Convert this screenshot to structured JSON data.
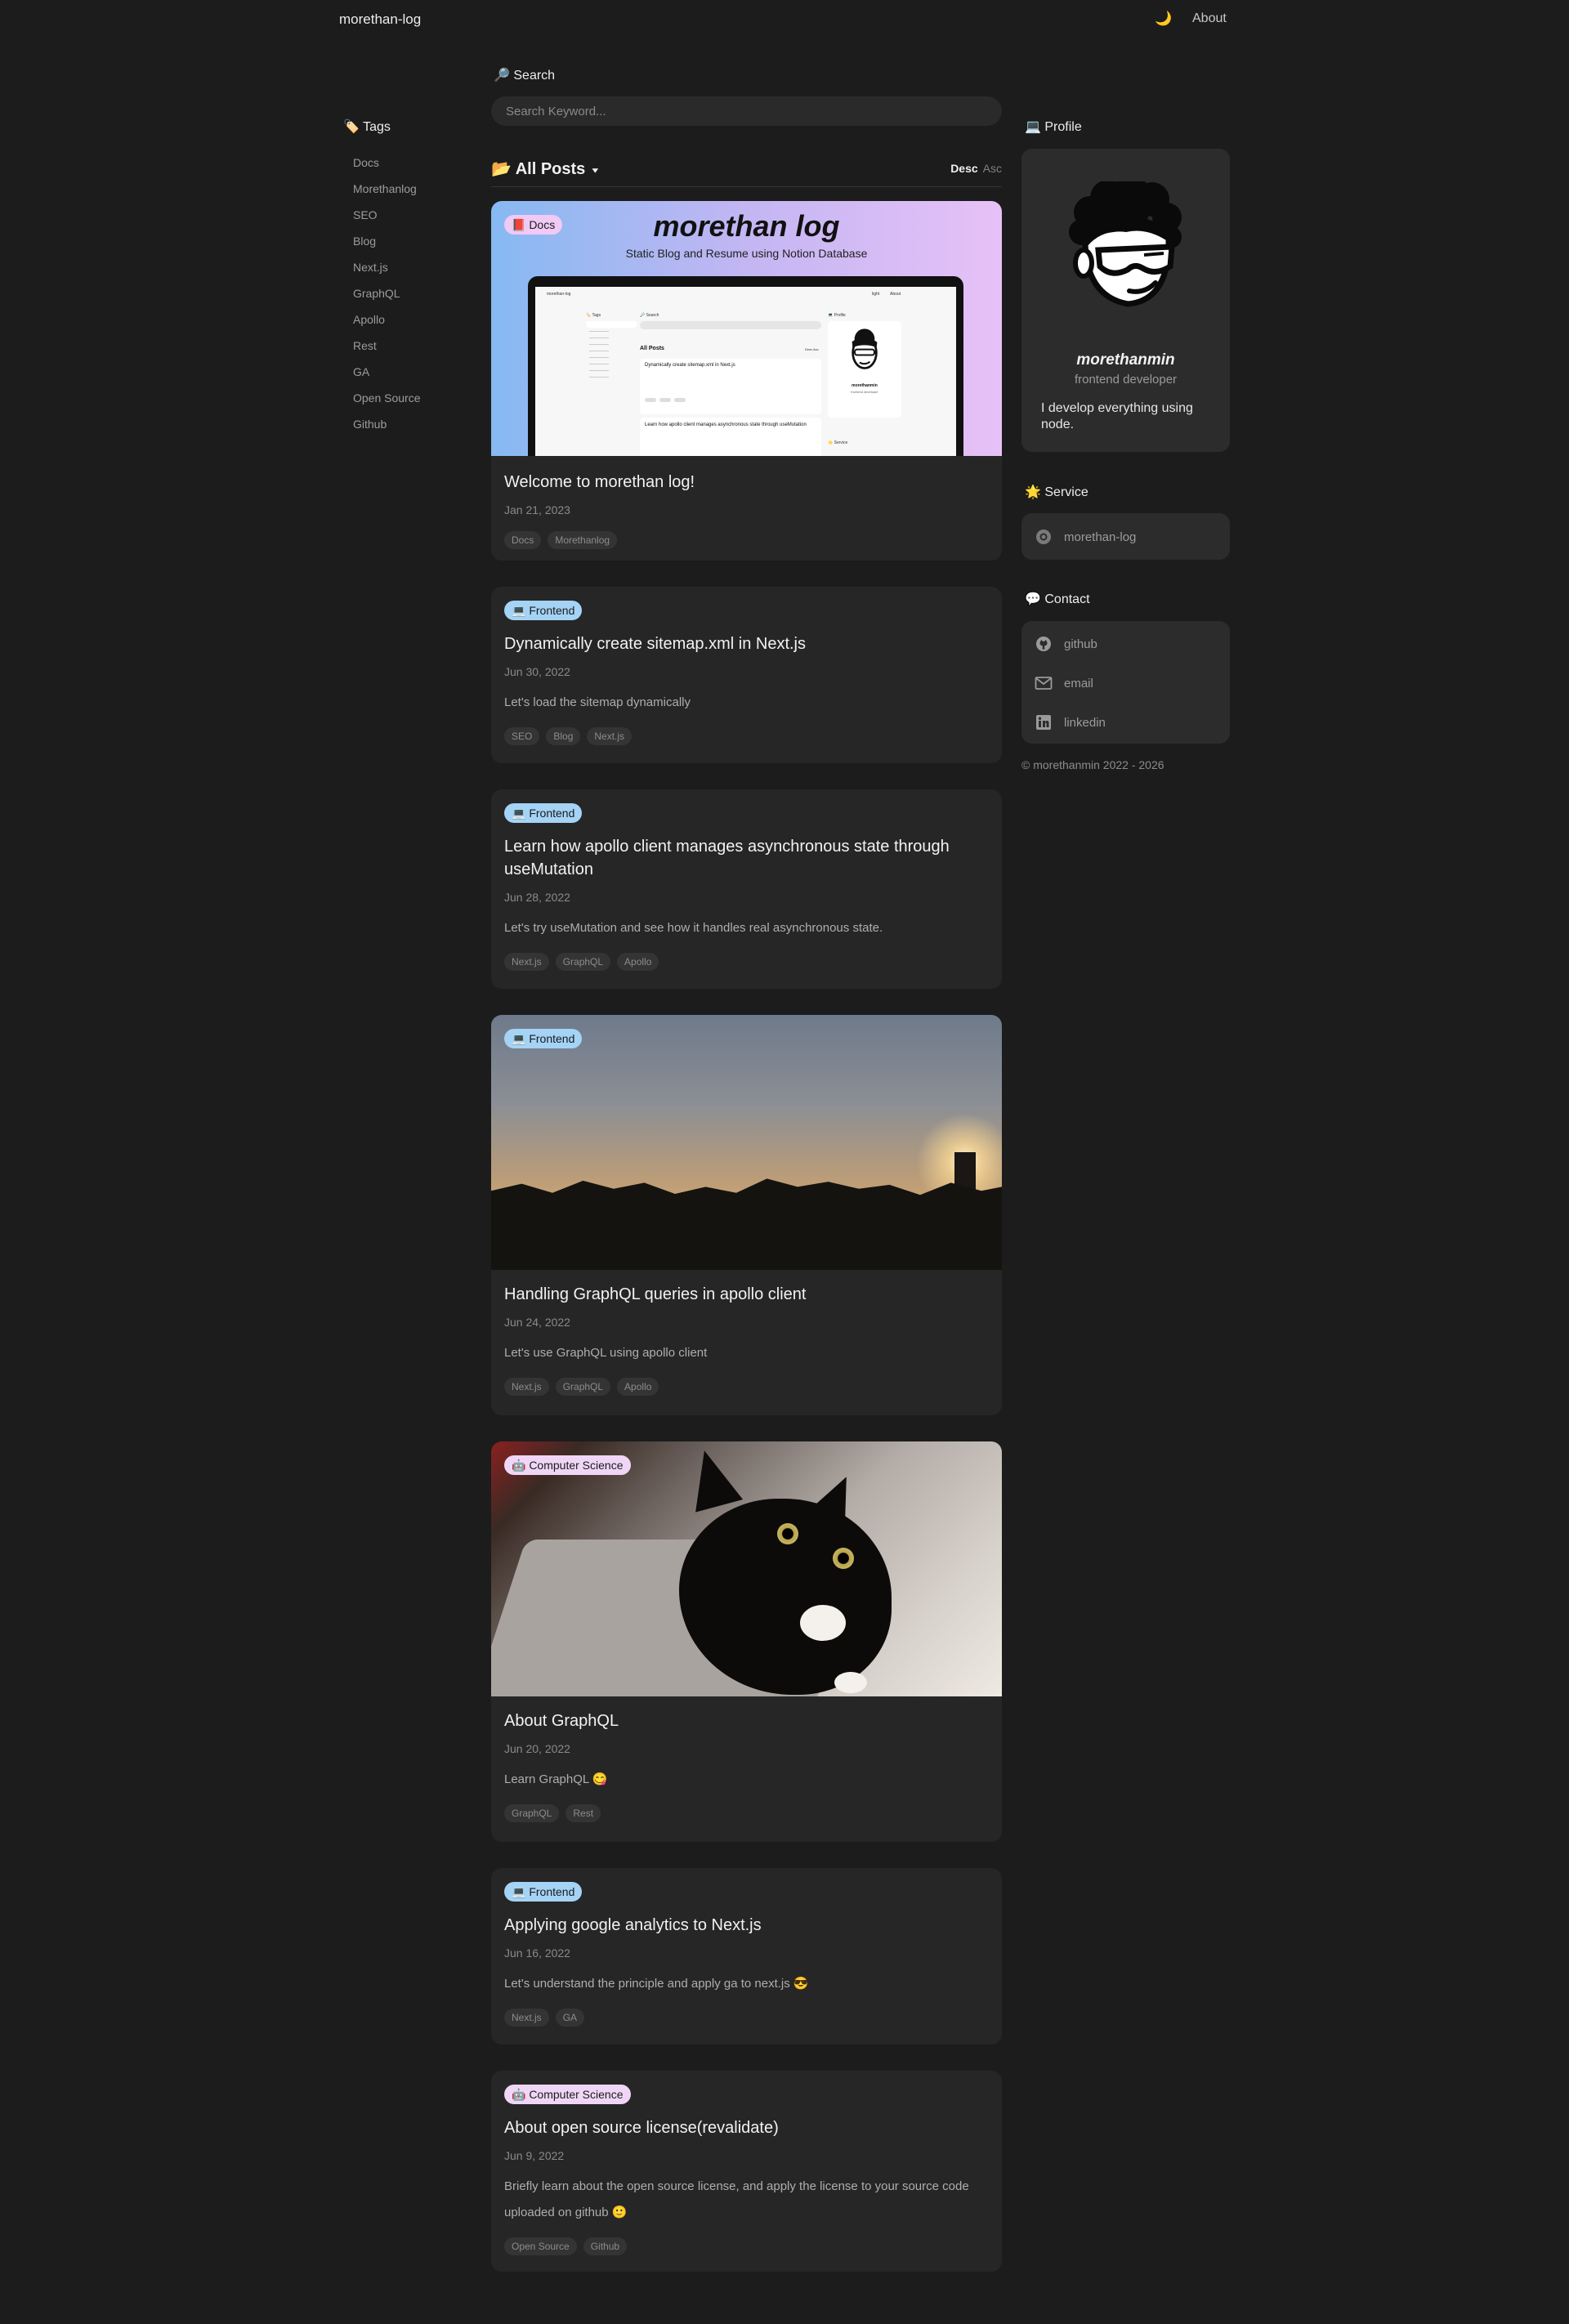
{
  "header": {
    "brand": "morethan-log",
    "theme_icon": "moon-icon",
    "about": "About"
  },
  "search": {
    "heading": "🔎 Search",
    "placeholder": "Search Keyword..."
  },
  "tags": {
    "heading": "🏷️ Tags",
    "items": [
      "Docs",
      "Morethanlog",
      "SEO",
      "Blog",
      "Next.js",
      "GraphQL",
      "Apollo",
      "Rest",
      "GA",
      "Open Source",
      "Github"
    ]
  },
  "feed": {
    "title": "📂 All Posts",
    "sort_desc": "Desc",
    "sort_asc": "Asc"
  },
  "posts": [
    {
      "category": "📕 Docs",
      "title": "Welcome to morethan log!",
      "date": "Jan 21, 2023",
      "summary": "",
      "tags": [
        "Docs",
        "Morethanlog"
      ],
      "thumb": {
        "heading": "morethan log",
        "subheading": "Static Blog and Resume using Notion Database",
        "mini_brand": "morethan-log",
        "mini_light": "light",
        "mini_about": "About",
        "mini_search": "🔎 Search",
        "mini_tags": "🏷️ Tags",
        "mini_feed": "All Posts",
        "mini_sort": "Desc Asc",
        "mini_profile": "💻 Profile",
        "mini_post1": "Dynamically create sitemap.xml in Next.js",
        "mini_post2": "Learn how apollo client manages asynchronous state through useMutation",
        "mini_name": "morethanmin",
        "mini_role": "frontend developer",
        "mini_service": "🌟 Service"
      }
    },
    {
      "category": "💻 Frontend",
      "title": "Dynamically create sitemap.xml in Next.js",
      "date": "Jun 30, 2022",
      "summary": "Let's load the sitemap dynamically",
      "tags": [
        "SEO",
        "Blog",
        "Next.js"
      ]
    },
    {
      "category": "💻 Frontend",
      "title": "Learn how apollo client manages asynchronous state through useMutation",
      "date": "Jun 28, 2022",
      "summary": "Let's try useMutation and see how it handles real asynchronous state.",
      "tags": [
        "Next.js",
        "GraphQL",
        "Apollo"
      ]
    },
    {
      "category": "💻 Frontend",
      "title": "Handling GraphQL queries in apollo client",
      "date": "Jun 24, 2022",
      "summary": "Let's use GraphQL using apollo client",
      "tags": [
        "Next.js",
        "GraphQL",
        "Apollo"
      ]
    },
    {
      "category": "🤖 Computer Science",
      "title": "About GraphQL",
      "date": "Jun 20, 2022",
      "summary": "Learn GraphQL 😋",
      "tags": [
        "GraphQL",
        "Rest"
      ]
    },
    {
      "category": "💻 Frontend",
      "title": "Applying google analytics to Next.js",
      "date": "Jun 16, 2022",
      "summary": "Let's understand the principle and apply ga to next.js 😎",
      "tags": [
        "Next.js",
        "GA"
      ]
    },
    {
      "category": "🤖 Computer Science",
      "title": "About open source license(revalidate)",
      "date": "Jun 9, 2022",
      "summary": "Briefly learn about the open source license, and apply the license to your source code uploaded on github 🙂",
      "tags": [
        "Open Source",
        "Github"
      ]
    }
  ],
  "profile": {
    "heading": "💻 Profile",
    "name": "morethanmin",
    "role": "frontend developer",
    "bio": "I develop everything using node."
  },
  "service": {
    "heading": "🌟 Service",
    "items": [
      {
        "icon": "globe-icon",
        "label": "morethan-log"
      }
    ]
  },
  "contact": {
    "heading": "💬 Contact",
    "items": [
      {
        "icon": "github-icon",
        "label": "github"
      },
      {
        "icon": "mail-icon",
        "label": "email"
      },
      {
        "icon": "linkedin-icon",
        "label": "linkedin"
      }
    ]
  },
  "footer": {
    "copyright": "© morethanmin 2022 - 2026"
  },
  "colors": {
    "background": "#1c1c1c",
    "card": "#262626",
    "sidebar_card": "#2c2c2c",
    "frontend_badge": "#a4d3f5",
    "cs_badge": "#f0d6f6"
  }
}
